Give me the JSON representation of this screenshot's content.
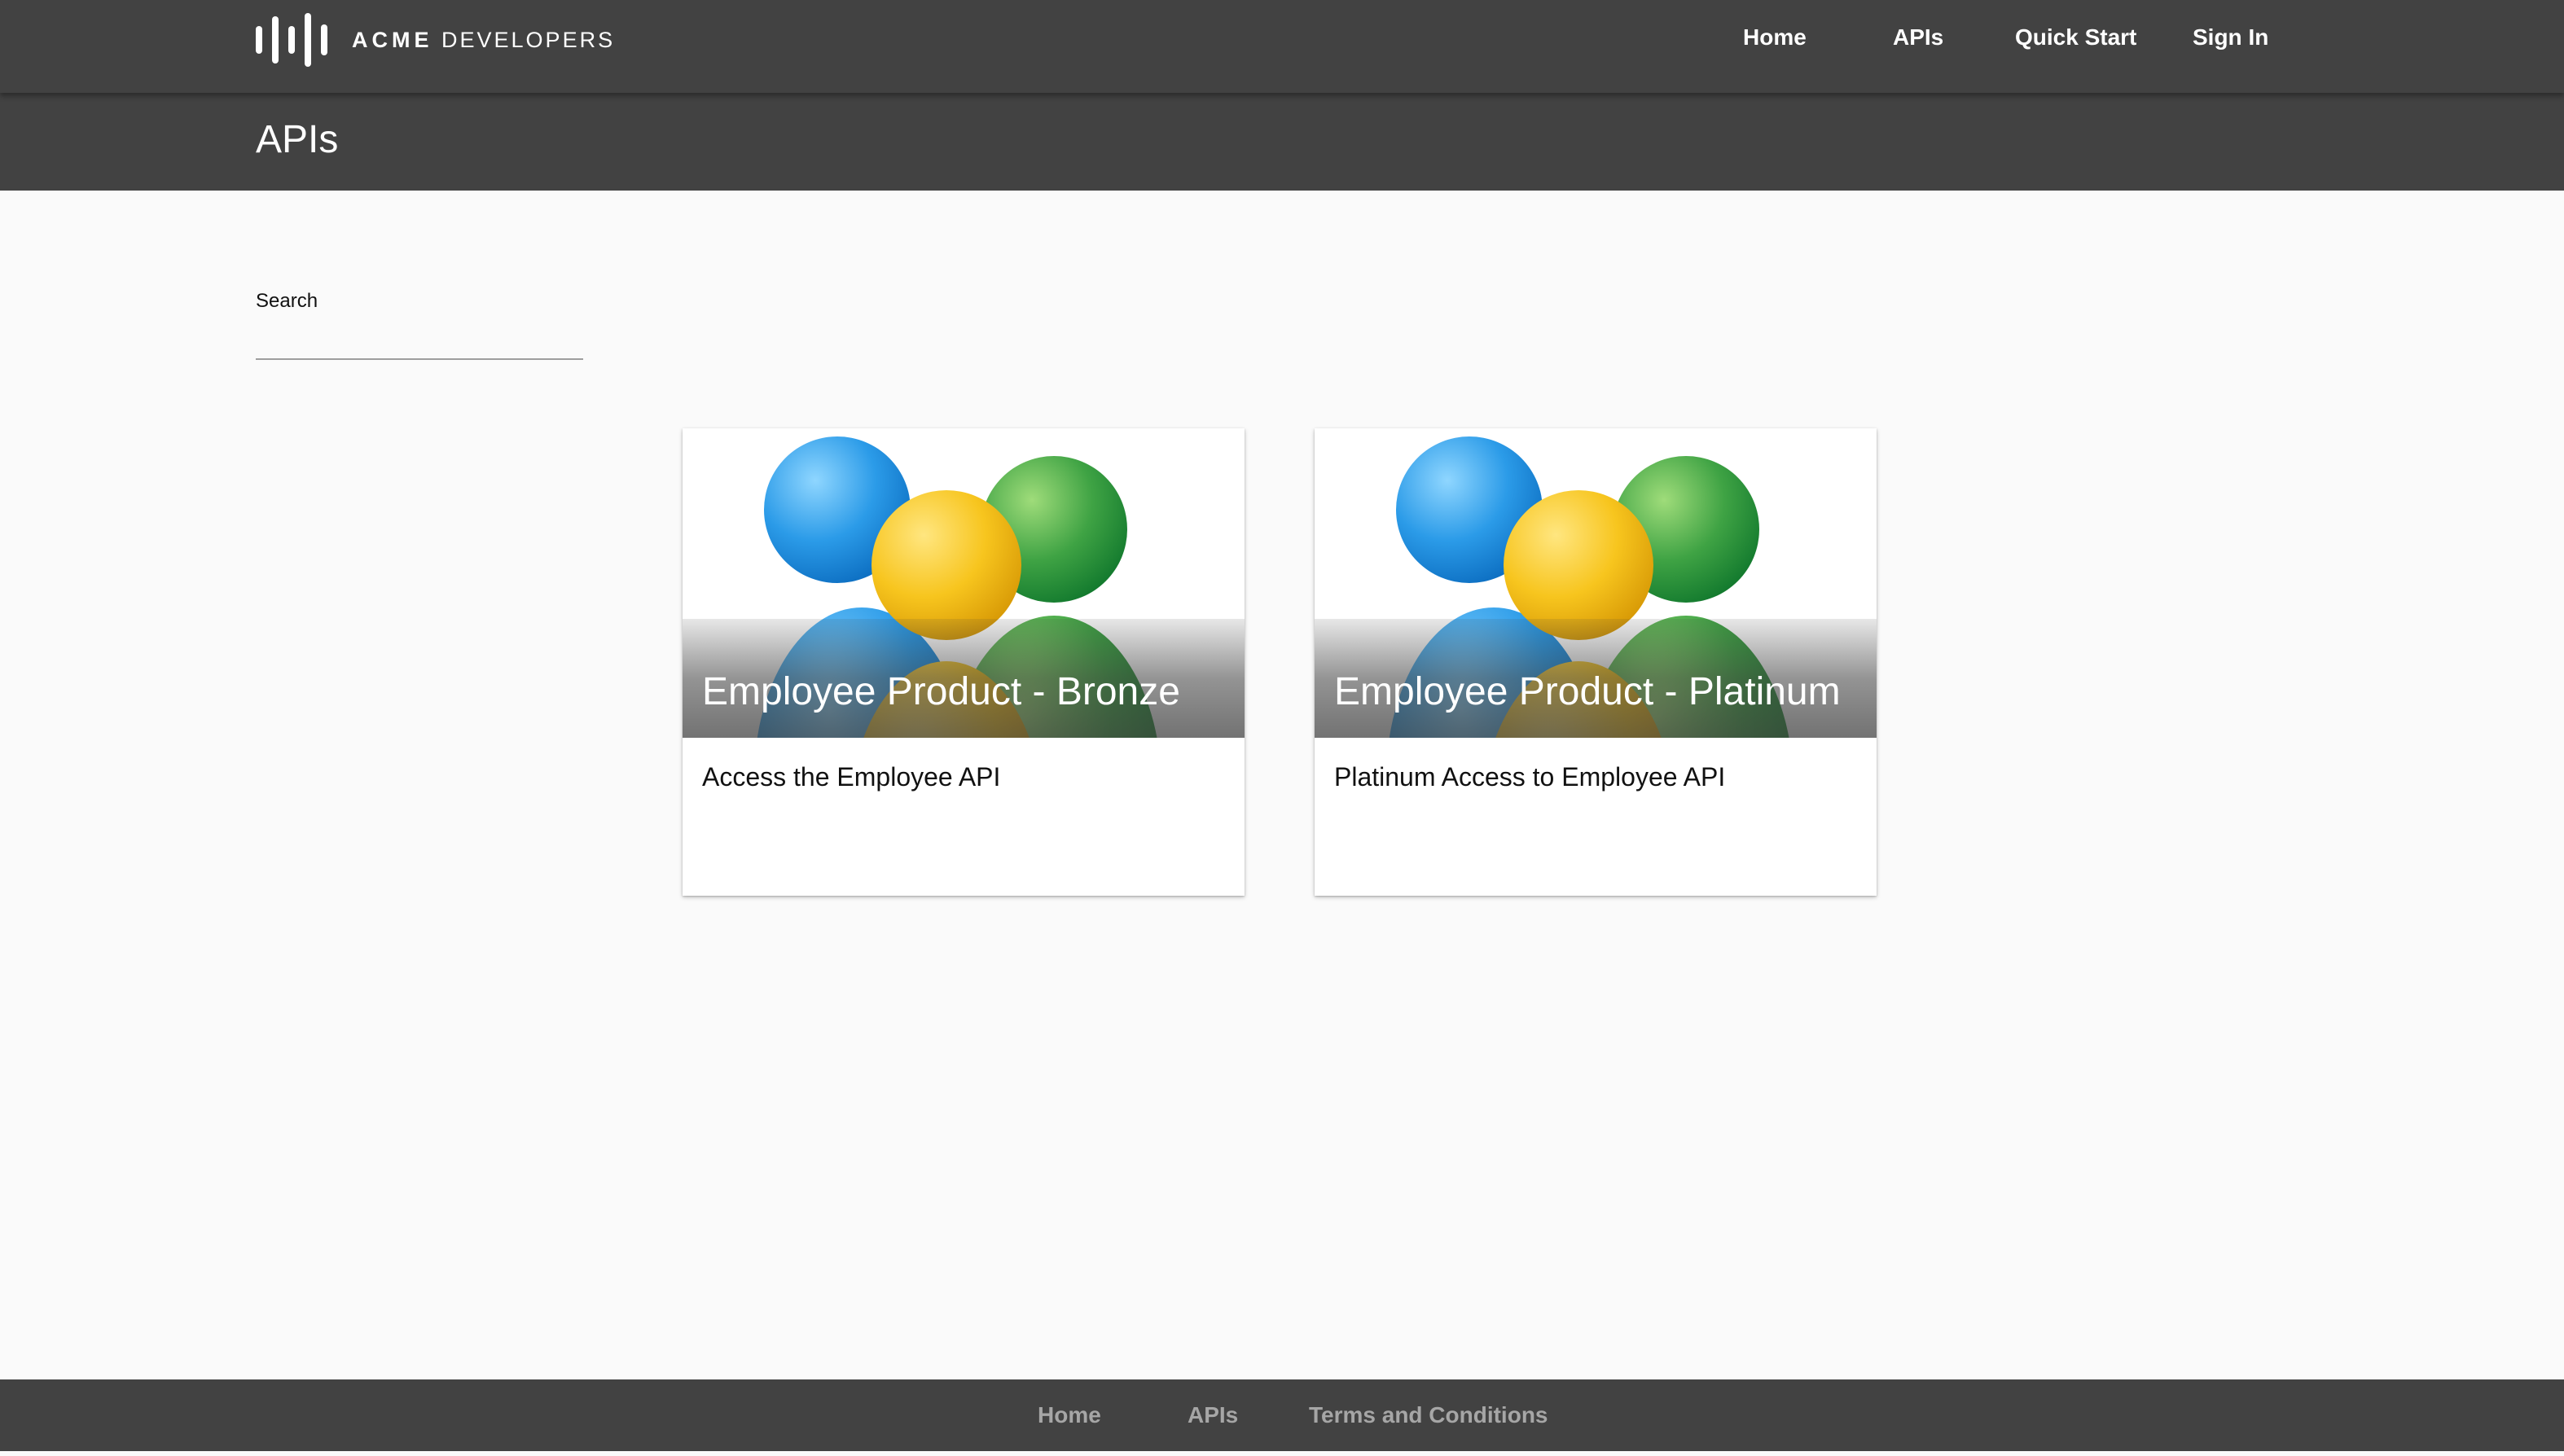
{
  "header": {
    "logo": {
      "brand": "ACME",
      "suffix": "DEVELOPERS"
    },
    "nav": [
      {
        "label": "Home"
      },
      {
        "label": "APIs"
      },
      {
        "label": "Quick Start"
      },
      {
        "label": "Sign In"
      }
    ]
  },
  "subheader": {
    "title": "APIs"
  },
  "search": {
    "label": "Search",
    "value": "",
    "placeholder": ""
  },
  "cards": [
    {
      "title": "Employee Product - Bronze",
      "description": "Access the Employee API",
      "image": "people-group-icon"
    },
    {
      "title": "Employee Product - Platinum",
      "description": "Platinum Access to Employee API",
      "image": "people-group-icon"
    }
  ],
  "footer": {
    "links": [
      {
        "label": "Home"
      },
      {
        "label": "APIs"
      },
      {
        "label": "Terms and Conditions"
      }
    ]
  },
  "colors": {
    "header_bg": "#424242",
    "page_bg": "#fafafa",
    "footer_link": "#a6a6a6",
    "person_blue": "#2b9be8",
    "person_green": "#3fa344",
    "person_yellow": "#f7c51e"
  }
}
